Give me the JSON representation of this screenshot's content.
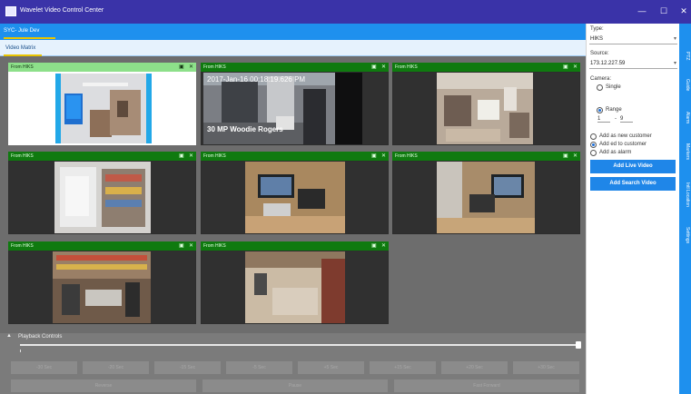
{
  "window": {
    "title": "Wavelet Video Control Center",
    "minimize": "—",
    "maximize": "☐",
    "close": "✕"
  },
  "tabs": {
    "document_tab": "SYC- Jule Dev",
    "subtab": "Video Matrix"
  },
  "matrix": {
    "tiles": [
      {
        "name": "From HIKS",
        "active": true,
        "overlay_top": "",
        "overlay_bottom": ""
      },
      {
        "name": "From HIKS",
        "active": false,
        "overlay_top": "2017-Jan-16 00:18:19.626 PM",
        "overlay_bottom": "30 MP Woodie Rogers"
      },
      {
        "name": "From HIKS",
        "active": false,
        "overlay_top": "",
        "overlay_bottom": ""
      },
      {
        "name": "From HIKS",
        "active": false,
        "overlay_top": "",
        "overlay_bottom": ""
      },
      {
        "name": "From HIKS",
        "active": false,
        "overlay_top": "",
        "overlay_bottom": ""
      },
      {
        "name": "From HIKS",
        "active": false,
        "overlay_top": "",
        "overlay_bottom": ""
      },
      {
        "name": "From HIKS",
        "active": false,
        "overlay_top": "",
        "overlay_bottom": ""
      },
      {
        "name": "From HIKS",
        "active": false,
        "overlay_top": "",
        "overlay_bottom": ""
      }
    ]
  },
  "playback": {
    "label": "Playback Controls",
    "skip_buttons": [
      "-30 Sec",
      "-20 Sec",
      "-15 Sec",
      "-5 Sec",
      "+5 Sec",
      "+15 Sec",
      "+20 Sec",
      "+30 Sec"
    ],
    "reverse": "Reverse",
    "pause": "Pause",
    "fast_forward": "Fast Forward",
    "position_fraction": 1.0
  },
  "sidebar": {
    "type_label": "Type:",
    "type_value": "HIKS",
    "source_label": "Source:",
    "source_value": "173.12.227.59",
    "camera_label": "Camera:",
    "single_label": "Single",
    "range_label": "Range",
    "range_from": "1",
    "range_sep": "-",
    "range_to": "9",
    "add_new_customer": "Add as new customer",
    "add_to_customer": "Add ed to customer",
    "add_as_alarm": "Add as alarm",
    "add_live_video": "Add Live Video",
    "add_search_video": "Add Search Video"
  },
  "right_rail": [
    "PTZ",
    "Guide",
    "Alarm",
    "Markers",
    "Intl Location",
    "Settings"
  ]
}
